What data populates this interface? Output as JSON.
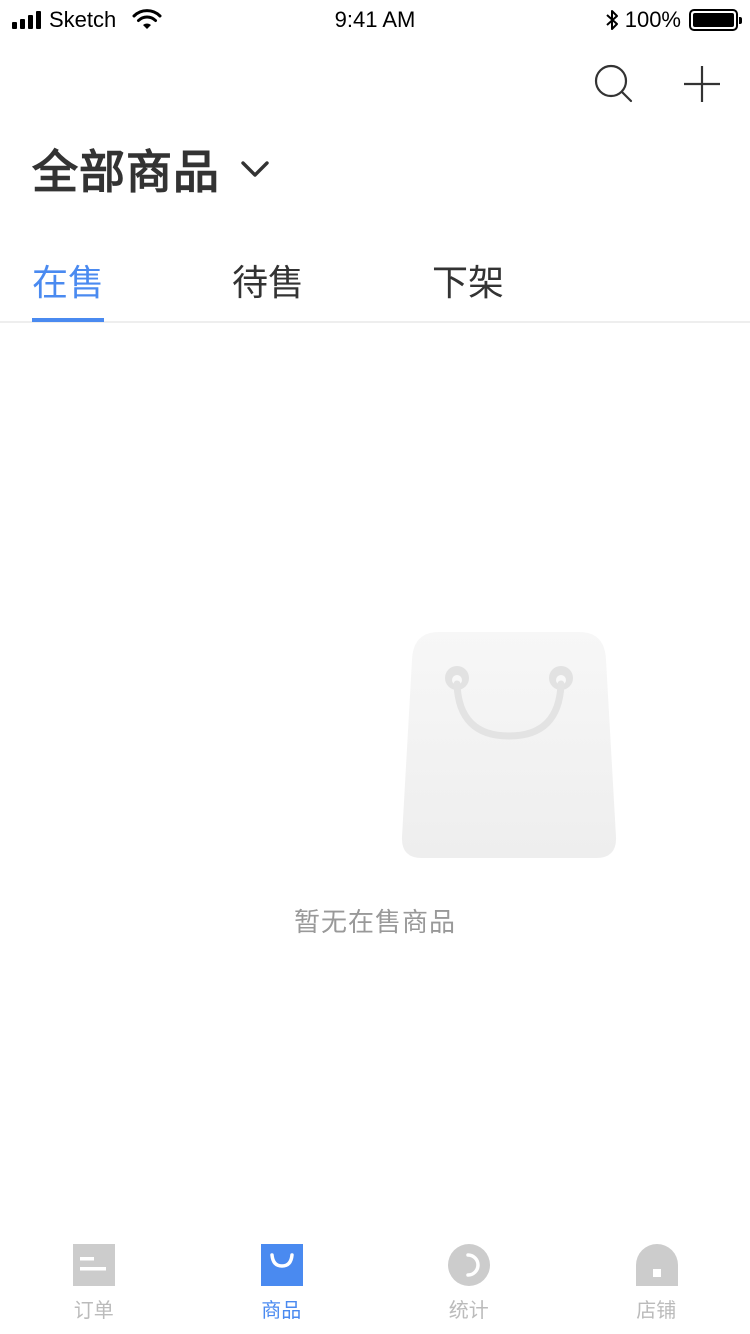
{
  "status_bar": {
    "carrier": "Sketch",
    "time": "9:41 AM",
    "battery": "100%",
    "battery_level": 1.0,
    "icons": [
      "signal-icon",
      "wifi-icon",
      "bluetooth-icon",
      "battery-icon"
    ]
  },
  "header": {
    "actions": [
      "search-icon",
      "plus-icon"
    ],
    "title": "全部商品",
    "title_icon": "chevron-down-icon"
  },
  "tabs": [
    {
      "label": "在售",
      "active": true
    },
    {
      "label": "待售",
      "active": false
    },
    {
      "label": "下架",
      "active": false
    }
  ],
  "empty_state": {
    "icon": "shopping-bag-icon",
    "text": "暂无在售商品"
  },
  "tabbar": [
    {
      "label": "订单",
      "icon": "orders-icon",
      "active": false
    },
    {
      "label": "商品",
      "icon": "products-icon",
      "active": true
    },
    {
      "label": "统计",
      "icon": "stats-icon",
      "active": false
    },
    {
      "label": "店铺",
      "icon": "store-icon",
      "active": false
    }
  ],
  "colors": {
    "accent": "#4a8af0",
    "text_primary": "#333333",
    "text_secondary": "#999999",
    "tab_inactive": "#bbbbbb",
    "divider": "#eeeeee"
  }
}
